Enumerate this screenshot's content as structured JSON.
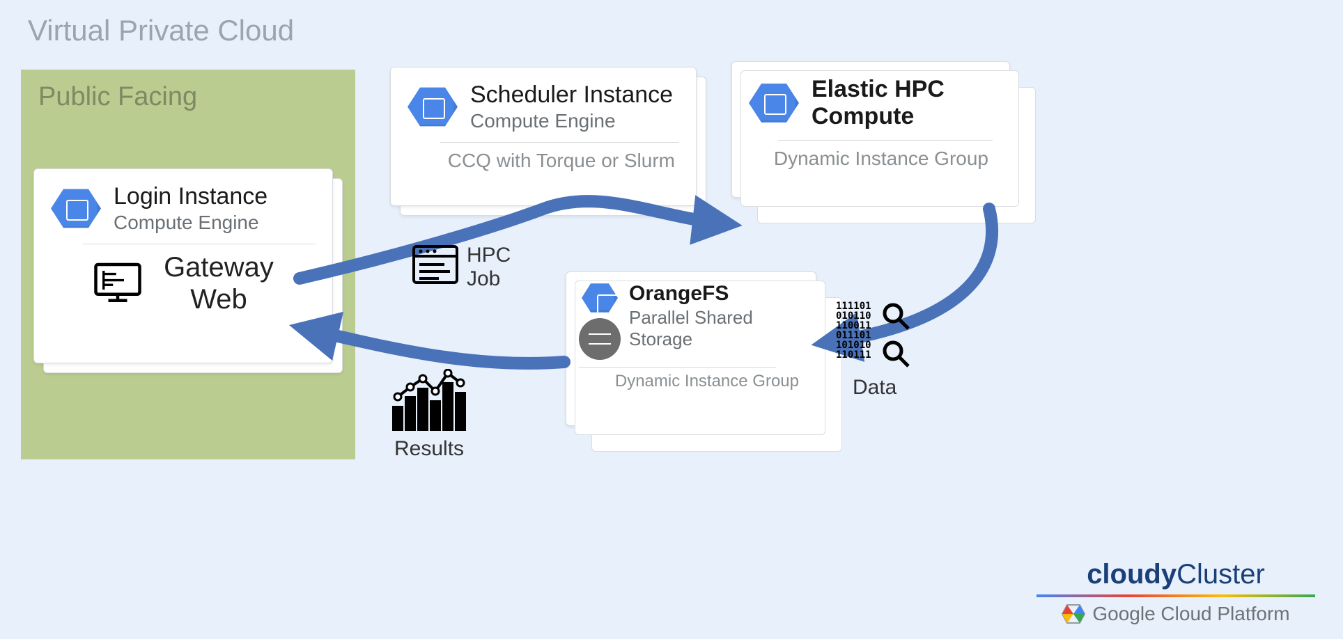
{
  "vpc_label": "Virtual Private Cloud",
  "public_label": "Public Facing",
  "login": {
    "title": "Login Instance",
    "subtitle": "Compute Engine",
    "gateway_line1": "Gateway",
    "gateway_line2": "Web"
  },
  "scheduler": {
    "title": "Scheduler Instance",
    "subtitle": "Compute Engine",
    "note": "CCQ with Torque or Slurm"
  },
  "elastic": {
    "title_line1": "Elastic HPC",
    "title_line2": "Compute",
    "note": "Dynamic Instance  Group"
  },
  "orangefs": {
    "title": "OrangeFS",
    "subtitle_line1": "Parallel Shared",
    "subtitle_line2": "Storage",
    "note": "Dynamic Instance Group"
  },
  "flow": {
    "hpc_label_line1": "HPC",
    "hpc_label_line2": "Job",
    "results_label": "Results",
    "data_label": "Data"
  },
  "logos": {
    "cloudy_part1": "cloudy",
    "cloudy_part2": "Cluster",
    "gcp": "Google Cloud Platform"
  },
  "colors": {
    "bg": "#e8f0fb",
    "public_box": "#b3c67d",
    "icon_blue": "#4a86e8",
    "arrow": "#4a72b8"
  }
}
